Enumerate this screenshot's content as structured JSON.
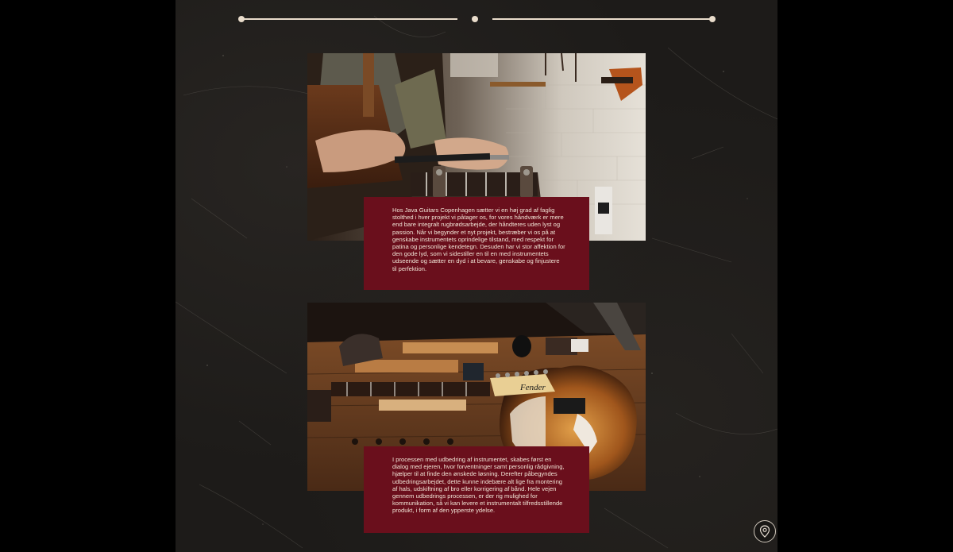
{
  "sections": [
    {
      "image_alt": "Luthier filing frets on a guitar neck in the workshop",
      "text": "Hos Java Guitars Copenhagen sætter vi en høj grad af faglig stolthed i hver projekt vi påtager os, for vores håndværk er mere end bare integralt rugbrødsarbejde, der håndteres uden lyst og passion. Når vi begynder et nyt projekt, bestræber vi os på at genskabe instrumentets oprindelige tilstand, med respekt for patina og personlige kendetegn. Desuden har vi stor affektion for den gode lyd, som vi sidestiller en til en med instrumentets udseende og sætter en dyd i at bevare, genskabe og finjustere til perfektion."
    },
    {
      "image_alt": "Disassembled sunburst Fender guitar and parts on a workbench",
      "text": "I processen med udbedring af instrumentet, skabes først en dialog med ejeren, hvor forventninger samt personlig rådgivning, hjælper til at finde den ønskede løsning. Derefter påbegyndes udbedringsarbejdet, dette kunne indebære alt lige fra montering af hals, udskiftning af bro eller korrigering af bånd. Hele vejen gennem udbedrings processen, er der rig mulighed for kommunikation, så vi kan levere et instrumentalt tilfredsstillende produkt, i form af den ypperste ydelse."
    }
  ],
  "headstock_logo": "Fender",
  "icons": {
    "location": "map-pin-icon"
  },
  "colors": {
    "page_background": "#000000",
    "panel_background": "#1d1b19",
    "accent_box": "#6a0f1c",
    "divider": "#e9dccb",
    "text_light": "#f1e4d6"
  }
}
